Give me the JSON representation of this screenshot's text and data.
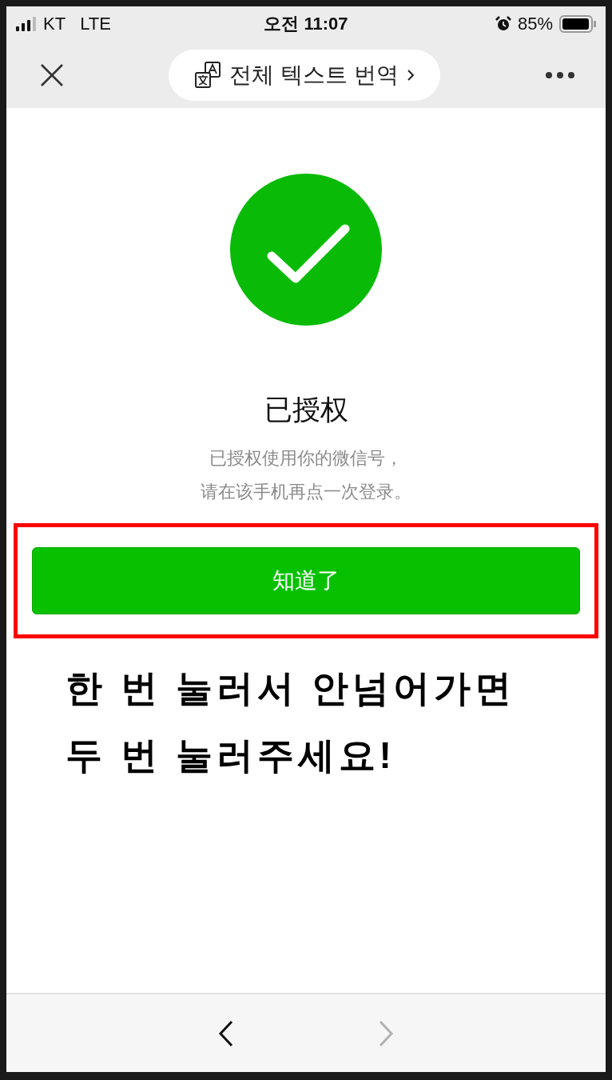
{
  "status_bar": {
    "carrier": "KT",
    "network": "LTE",
    "time": "오전 11:07",
    "battery": "85%",
    "alarm": true
  },
  "nav_bar": {
    "translate_label": "전체 텍스트 번역"
  },
  "result": {
    "title": "已授权",
    "message_lines": [
      "已授权使用你的微信号，",
      "请在该手机再点一次登录。"
    ],
    "button": "知道了"
  },
  "annotation": {
    "highlighted": true,
    "lines": [
      "한 번 눌러서 안넘어가면",
      "두 번 눌러주세요!"
    ]
  },
  "toolbar": [
    {
      "kind": "back",
      "disabled": false
    },
    {
      "kind": "forward",
      "disabled": true
    }
  ]
}
